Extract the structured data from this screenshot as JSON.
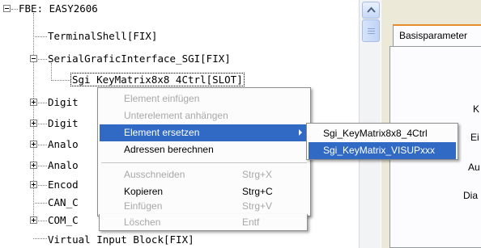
{
  "tree": {
    "nodes": [
      {
        "label": "FBE: EASY2606",
        "expander": "minus"
      },
      {
        "label": "TerminalShell[FIX]",
        "expander": "none"
      },
      {
        "label": "SerialGraficInterface_SGI[FIX]",
        "expander": "minus"
      },
      {
        "label": "Sgi KeyMatrix8x8 4Ctrl[SLOT]",
        "expander": "none",
        "selected": true
      },
      {
        "label": "Digit",
        "expander": "plus"
      },
      {
        "label": "Digit",
        "expander": "plus"
      },
      {
        "label": "Analo",
        "expander": "plus"
      },
      {
        "label": "Analo",
        "expander": "plus"
      },
      {
        "label": "Encod",
        "expander": "plus"
      },
      {
        "label": "CAN_C",
        "expander": "none"
      },
      {
        "label": "COM_C",
        "expander": "plus"
      },
      {
        "label": "Virtual Input Block[FIX]",
        "expander": "none"
      }
    ]
  },
  "right_panel": {
    "tab_label": "Basisparameter",
    "labels": [
      "K",
      "Ei",
      "Au",
      "Dia"
    ]
  },
  "context_menu": {
    "items": [
      {
        "label": "Element einfügen",
        "shortcut": "",
        "enabled": false
      },
      {
        "label": "Unterelement anhängen",
        "shortcut": "",
        "enabled": false
      },
      {
        "label": "Element ersetzen",
        "shortcut": "",
        "enabled": true,
        "submenu": true,
        "active": true
      },
      {
        "label": "Adressen berechnen",
        "shortcut": "",
        "enabled": true
      },
      {
        "label": "Ausschneiden",
        "shortcut": "Strg+X",
        "enabled": false
      },
      {
        "label": "Kopieren",
        "shortcut": "Strg+C",
        "enabled": true
      },
      {
        "label": "Einfügen",
        "shortcut": "Strg+V",
        "enabled": false
      },
      {
        "label": "Löschen",
        "shortcut": "Entf",
        "enabled": false
      }
    ]
  },
  "submenu": {
    "items": [
      {
        "label": "Sgi_KeyMatrix8x8_4Ctrl",
        "active": false
      },
      {
        "label": "Sgi_KeyMatrix_VISUPxxx",
        "active": true
      }
    ]
  },
  "colors": {
    "menu_highlight": "#316ac5",
    "disabled_text": "#a8a8a8",
    "tab_accent": "#e68b2c",
    "panel_background": "#ece9d8"
  }
}
